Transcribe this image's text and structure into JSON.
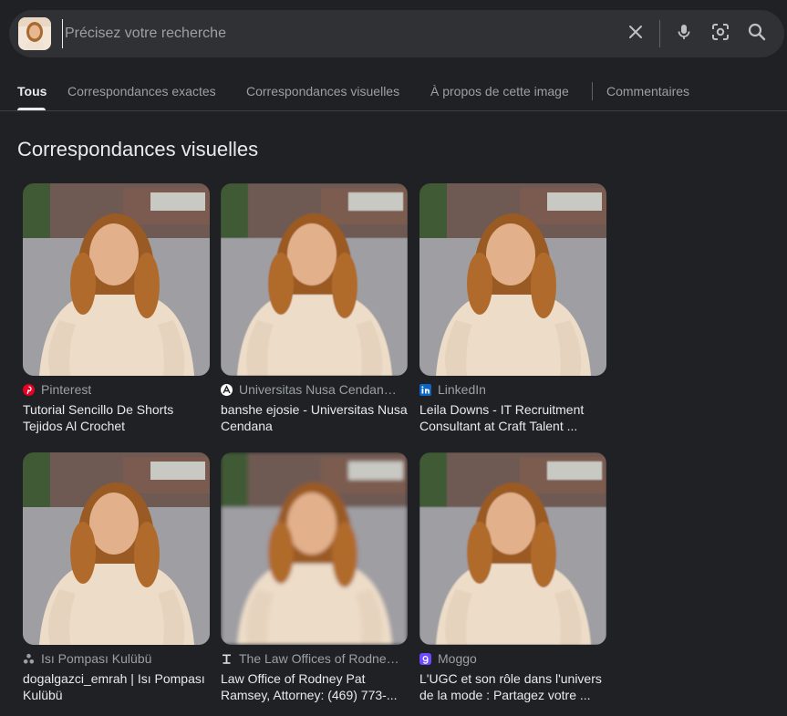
{
  "search": {
    "placeholder": "Précisez votre recherche",
    "value": ""
  },
  "icons": {
    "clear": "close-icon",
    "voice": "microphone-icon",
    "lens": "camera-lens-icon",
    "search": "search-icon"
  },
  "tabs": [
    {
      "label": "Tous",
      "active": true
    },
    {
      "label": "Correspondances exactes",
      "active": false
    },
    {
      "label": "Correspondances visuelles",
      "active": false
    },
    {
      "label": "À propos de cette image",
      "active": false
    },
    {
      "label": "Commentaires",
      "active": false
    }
  ],
  "section": {
    "title": "Correspondances visuelles"
  },
  "results": [
    {
      "source": "Pinterest",
      "icon": "pinterest-icon",
      "icon_color": "#e60023",
      "title": "Tutorial Sencillo De Shorts Tejidos Al Crochet"
    },
    {
      "source": "Universitas Nusa Cendan…",
      "icon": "university-logo-icon",
      "icon_color": "#ffffff",
      "title": "banshe ejosie - Universitas Nusa Cendana"
    },
    {
      "source": "LinkedIn",
      "icon": "linkedin-icon",
      "icon_color": "#0a66c2",
      "title": "Leila Downs - IT Recruitment Consultant at Craft Talent ..."
    },
    {
      "source": "Isı Pompası Kulübü",
      "icon": "heat-pump-icon",
      "icon_color": "#9aa0a6",
      "title": "dogalgazci_emrah | Isı Pompası Kulübü"
    },
    {
      "source": "The Law Offices of Rodne…",
      "icon": "law-office-icon",
      "icon_color": "#dadce0",
      "title": "Law Office of Rodney Pat Ramsey, Attorney: (469) 773-..."
    },
    {
      "source": "Moggo",
      "icon": "moggo-icon",
      "icon_color": "#6d4aff",
      "title": "L'UGC et son rôle dans l'univers de la mode : Partagez votre ..."
    }
  ]
}
